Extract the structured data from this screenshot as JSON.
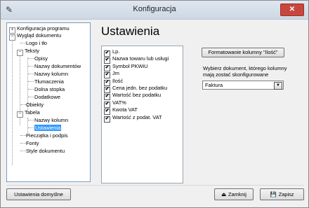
{
  "window": {
    "title": "Konfiguracja",
    "icon": "wrench-icon",
    "close_label": "✕"
  },
  "tree": {
    "konfiguracja_programu": "Konfiguracja programu",
    "wyglad_dokumentu": "Wygląd dokumentu",
    "logo": "Logo i tło",
    "teksty": "Teksty",
    "opisy": "Opisy",
    "nazwy_dokumentow": "Nazwy dokumentów",
    "nazwy_kolumn": "Nazwy kolumn",
    "tlumaczenia": "Tłumaczenia",
    "dolna_stopka": "Dolna stopka",
    "dodatkowe": "Dodatkowe",
    "obiekty": "Obiekty",
    "tabela": "Tabela",
    "tabela_nazwy_kolumn": "Nazwy kolumn",
    "ustawienia": "Ustawienia",
    "pieczatka": "Pieczątka i podpis",
    "fonty": "Fonty",
    "style_dokumentu": "Style dokumentu",
    "plus": "+",
    "minus": "−"
  },
  "content": {
    "title": "Ustawienia"
  },
  "columns": {
    "check_mark": "✔",
    "items": [
      "Lp.",
      "Nazwa towaru lub usługi",
      "Symbol PKWiU",
      "Jm",
      "Ilość",
      "Cena jedn. bez podatku",
      "Wartość bez podatku",
      "VAT%",
      "Kwota VAT",
      "Wartość z podat. VAT"
    ]
  },
  "format_button": "Formatowanie kolumny \"Ilość\"",
  "choose_label": "Wybierz dokument, którego kolumny mają zostać skonfigurowane",
  "document_select": {
    "value": "Faktura",
    "arrow": "▼"
  },
  "footer": {
    "defaults_label": "Ustawienia domyślne",
    "close_label": "Zamknij",
    "close_icon": "⏏",
    "save_label": "Zapisz",
    "save_icon": "💾"
  }
}
